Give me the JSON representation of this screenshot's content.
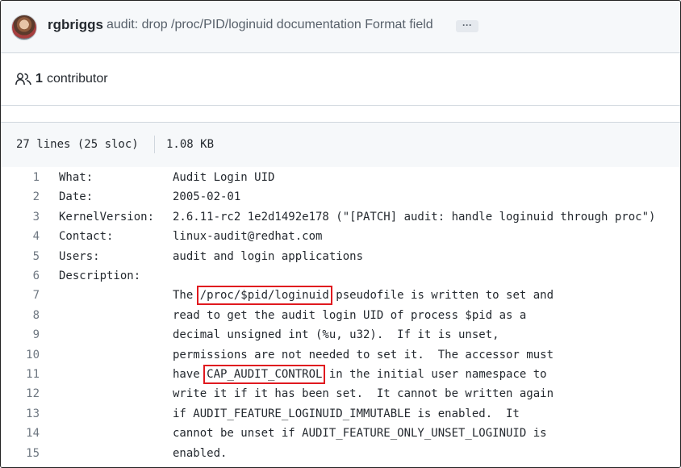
{
  "commit": {
    "author": "rgbriggs",
    "message": "audit: drop /proc/PID/loginuid documentation Format field",
    "ellipsis": "···"
  },
  "contributors": {
    "count": "1",
    "label": "contributor"
  },
  "file": {
    "lines": "27 lines (25 sloc)",
    "size": "1.08 KB"
  },
  "code": {
    "lines": [
      {
        "n": "1",
        "key": "What:",
        "val": "Audit Login UID"
      },
      {
        "n": "2",
        "key": "Date:",
        "val": "2005-02-01"
      },
      {
        "n": "3",
        "key": "KernelVersion:",
        "val": "2.6.11-rc2 1e2d1492e178 (\"[PATCH] audit: handle loginuid through proc\")"
      },
      {
        "n": "4",
        "key": "Contact:",
        "val": "linux-audit@redhat.com"
      },
      {
        "n": "5",
        "key": "Users:",
        "val": "audit and login applications"
      },
      {
        "n": "6",
        "key": "Description:",
        "val": ""
      },
      {
        "n": "7",
        "key": "",
        "pre": "The ",
        "hl": "/proc/$pid/loginuid",
        "post": " pseudofile is written to set and"
      },
      {
        "n": "8",
        "key": "",
        "val": "read to get the audit login UID of process $pid as a"
      },
      {
        "n": "9",
        "key": "",
        "val": "decimal unsigned int (%u, u32).  If it is unset,"
      },
      {
        "n": "10",
        "key": "",
        "val": "permissions are not needed to set it.  The accessor must"
      },
      {
        "n": "11",
        "key": "",
        "pre": "have ",
        "hl": "CAP_AUDIT_CONTROL",
        "post": " in the initial user namespace to"
      },
      {
        "n": "12",
        "key": "",
        "val": "write it if it has been set.  It cannot be written again"
      },
      {
        "n": "13",
        "key": "",
        "val": "if AUDIT_FEATURE_LOGINUID_IMMUTABLE is enabled.  It"
      },
      {
        "n": "14",
        "key": "",
        "val": "cannot be unset if AUDIT_FEATURE_ONLY_UNSET_LOGINUID is"
      },
      {
        "n": "15",
        "key": "",
        "val": "enabled."
      }
    ]
  },
  "colors": {
    "highlight_box": "#e0191f",
    "header_bg": "#f6f8fa",
    "line_number": "#6e7781"
  }
}
